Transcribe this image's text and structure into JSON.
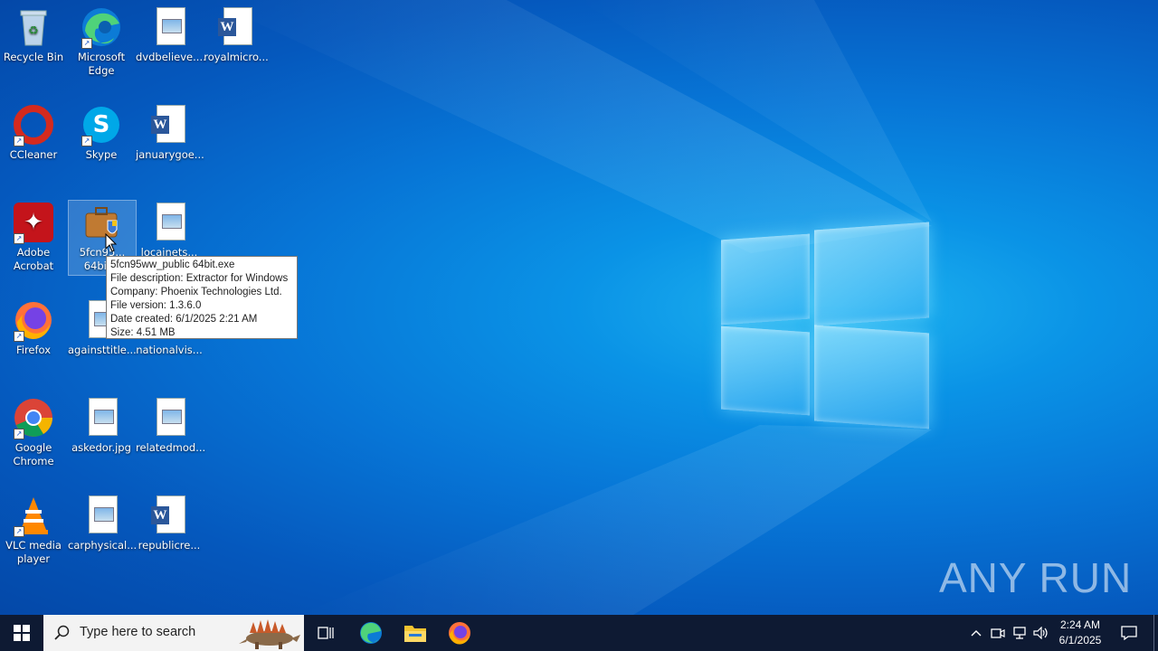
{
  "desktop": {
    "icons": [
      {
        "label": "Recycle Bin"
      },
      {
        "label": "Microsoft Edge"
      },
      {
        "label": "dvdbelieve...."
      },
      {
        "label": "royalmicro..."
      },
      {
        "label": "CCleaner"
      },
      {
        "label": "Skype"
      },
      {
        "label": "januarygoe..."
      },
      {
        "label": "Adobe Acrobat"
      },
      {
        "label": "5fcn95... 64bit..."
      },
      {
        "label": "locainets..."
      },
      {
        "label": "Firefox"
      },
      {
        "label": "againsttitle..."
      },
      {
        "label": "nationalvis..."
      },
      {
        "label": "Google Chrome"
      },
      {
        "label": "askedor.jpg"
      },
      {
        "label": "relatedmod..."
      },
      {
        "label": "VLC media player"
      },
      {
        "label": "carphysical..."
      },
      {
        "label": "republicre..."
      }
    ]
  },
  "tooltip": {
    "lines": [
      "5fcn95ww_public 64bit.exe",
      "File description: Extractor for Windows",
      "Company: Phoenix Technologies Ltd.",
      "File version: 1.3.6.0",
      "Date created: 6/1/2025 2:21 AM",
      "Size: 4.51 MB"
    ]
  },
  "watermark": "ANY RUN",
  "taskbar": {
    "search_placeholder": "Type here to search",
    "time": "2:24 AM",
    "date": "6/1/2025",
    "pinned": [
      "task-view-icon",
      "edge-icon",
      "file-explorer-icon",
      "firefox-icon"
    ]
  },
  "colors": {
    "taskbar": "#0e1a33",
    "desktop_accent": "#0a93e6",
    "tooltip_bg": "#ffffff"
  }
}
